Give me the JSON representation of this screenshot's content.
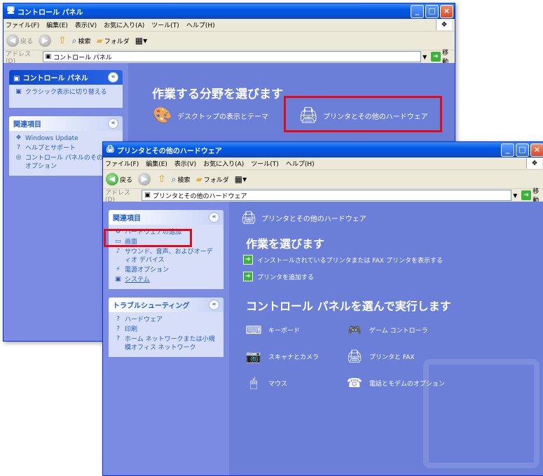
{
  "back_window": {
    "title": "コントロール パネル",
    "menu": [
      "ファイル(F)",
      "編集(E)",
      "表示(V)",
      "お気に入り(A)",
      "ツール(T)",
      "ヘルプ(H)"
    ],
    "toolbar": {
      "back": "戻る",
      "search": "検索",
      "folders": "フォルダ"
    },
    "address_label": "アドレス(D)",
    "address_value": "コントロール パネル",
    "go_label": "移動",
    "side_panel_title": "コントロール パネル",
    "classic_view_link": "クラシック表示に切り替える",
    "related_title": "関連項目",
    "related_items": [
      "Windows Update",
      "ヘルプとサポート",
      "コントロール パネルのその他のオプション"
    ],
    "heading": "作業する分野を選びます",
    "category_1": "デスクトップの表示とテーマ",
    "category_2": "プリンタとその他のハードウェア"
  },
  "front_window": {
    "title": "プリンタとその他のハードウェア",
    "menu": [
      "ファイル(F)",
      "編集(E)",
      "表示(V)",
      "お気に入り(A)",
      "ツール(T)",
      "ヘルプ(H)"
    ],
    "toolbar": {
      "back": "戻る",
      "search": "検索",
      "folders": "フォルダ"
    },
    "address_label": "アドレス(D)",
    "address_value": "プリンタとその他のハードウェア",
    "go_label": "移動",
    "related_title": "関連項目",
    "related_items": [
      "ハードウェアの追加",
      "画面",
      "サウンド、音声、およびオーディオ デバイス",
      "電源オプション",
      "システム"
    ],
    "troubleshoot_title": "トラブルシューティング",
    "troubleshoot_items": [
      "ハードウェア",
      "印刷",
      "ホーム ネットワークまたは小規模オフィス ネットワーク"
    ],
    "page_header": "プリンタとその他のハードウェア",
    "tasks_heading": "作業を選びます",
    "tasks": [
      "インストールされているプリンタまたは FAX プリンタを表示する",
      "プリンタを追加する"
    ],
    "panels_heading": "コントロール パネルを選んで実行します",
    "panels": [
      "キーボード",
      "ゲーム コントローラ",
      "スキャナとカメラ",
      "プリンタと FAX",
      "マウス",
      "電話とモデムのオプション"
    ]
  },
  "colors": {
    "highlight": "#e30b17",
    "content_bg": "#6b7fd9",
    "link_blue": "#215dc6"
  }
}
